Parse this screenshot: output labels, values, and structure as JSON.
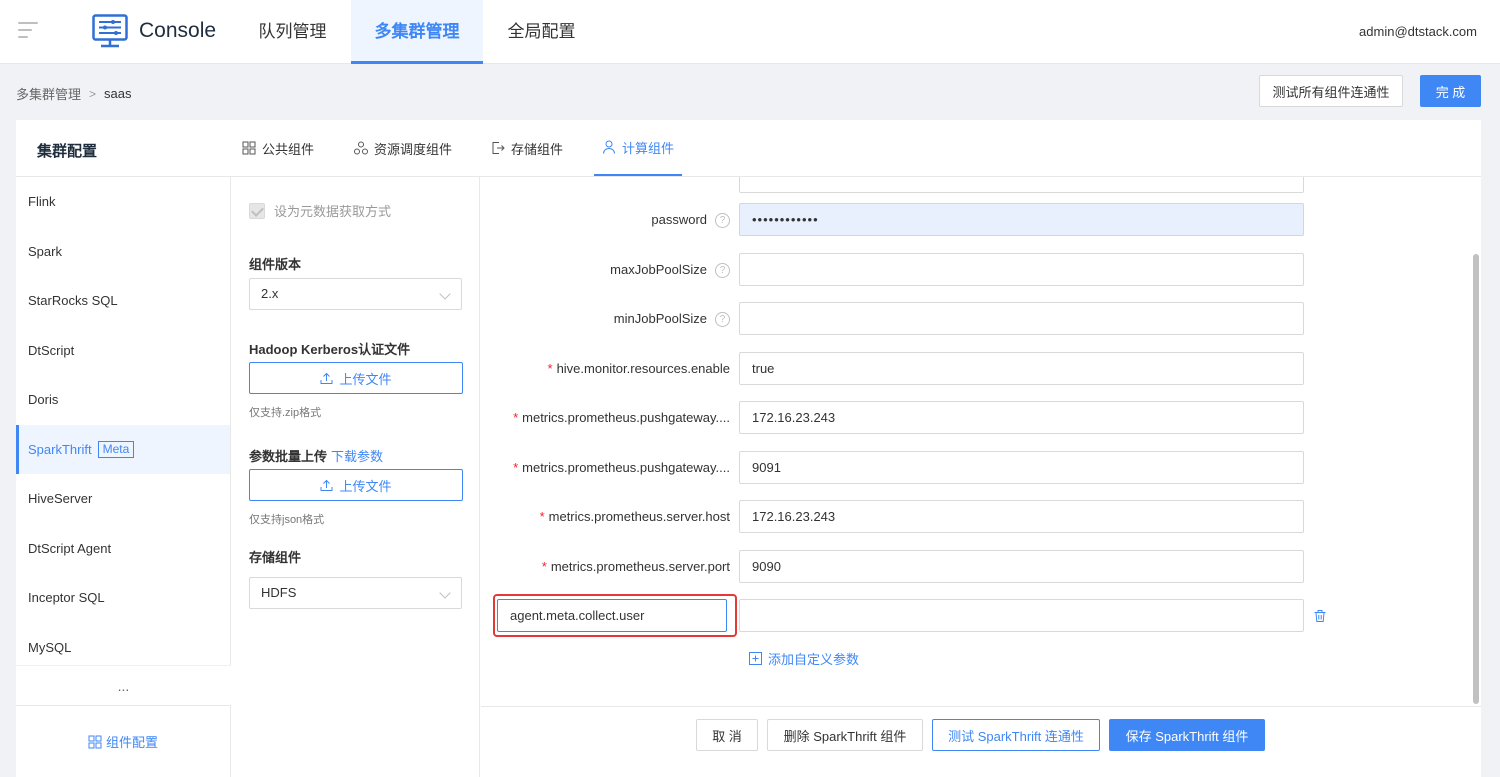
{
  "topnav": {
    "brand": "Console",
    "tabs": [
      "队列管理",
      "多集群管理",
      "全局配置"
    ],
    "active_tab": "多集群管理",
    "user": "admin@dtstack.com"
  },
  "breadcrumb": {
    "parent": "多集群管理",
    "separator": ">",
    "current": "saas"
  },
  "actions": {
    "test_all": "测试所有组件连通性",
    "done": "完 成"
  },
  "card": {
    "title": "集群配置",
    "tabs": [
      "公共组件",
      "资源调度组件",
      "存储组件",
      "计算组件"
    ],
    "active_tab": "计算组件"
  },
  "components": {
    "items": [
      "Flink",
      "Spark",
      "StarRocks SQL",
      "DtScript",
      "Doris",
      "SparkThrift",
      "HiveServer",
      "DtScript Agent",
      "Inceptor SQL",
      "MySQL"
    ],
    "active": "SparkThrift",
    "active_tag": "Meta",
    "more": "...",
    "config_button": "组件配置"
  },
  "settings": {
    "metadata_checkbox": "设为元数据获取方式",
    "version_label": "组件版本",
    "version_value": "2.x",
    "kerberos_label": "Hadoop Kerberos认证文件",
    "upload_label": "上传文件",
    "zip_hint": "仅支持.zip格式",
    "batch_label": "参数批量上传",
    "download_params": "下载参数",
    "json_hint": "仅支持json格式",
    "storage_label": "存储组件",
    "storage_value": "HDFS"
  },
  "form": {
    "fields": [
      {
        "label": "password",
        "value": "••••••••••••",
        "required": false,
        "help": true
      },
      {
        "label": "maxJobPoolSize",
        "value": "",
        "required": false,
        "help": true
      },
      {
        "label": "minJobPoolSize",
        "value": "",
        "required": false,
        "help": true
      },
      {
        "label": "hive.monitor.resources.enable",
        "value": "true",
        "required": true,
        "help": false
      },
      {
        "label": "metrics.prometheus.pushgateway....",
        "value": "172.16.23.243",
        "required": true,
        "help": false
      },
      {
        "label": "metrics.prometheus.pushgateway....",
        "value": "9091",
        "required": true,
        "help": false
      },
      {
        "label": "metrics.prometheus.server.host",
        "value": "172.16.23.243",
        "required": true,
        "help": false
      },
      {
        "label": "metrics.prometheus.server.port",
        "value": "9090",
        "required": true,
        "help": false
      }
    ],
    "custom_key": "agent.meta.collect.user",
    "custom_value": "",
    "add_param": "添加自定义参数"
  },
  "footer": {
    "cancel": "取 消",
    "delete": "删除 SparkThrift 组件",
    "test": "测试 SparkThrift 连通性",
    "save": "保存 SparkThrift 组件"
  },
  "colors": {
    "accent": "#3f87f5",
    "required": "#f5222d",
    "highlight": "#e53935"
  }
}
